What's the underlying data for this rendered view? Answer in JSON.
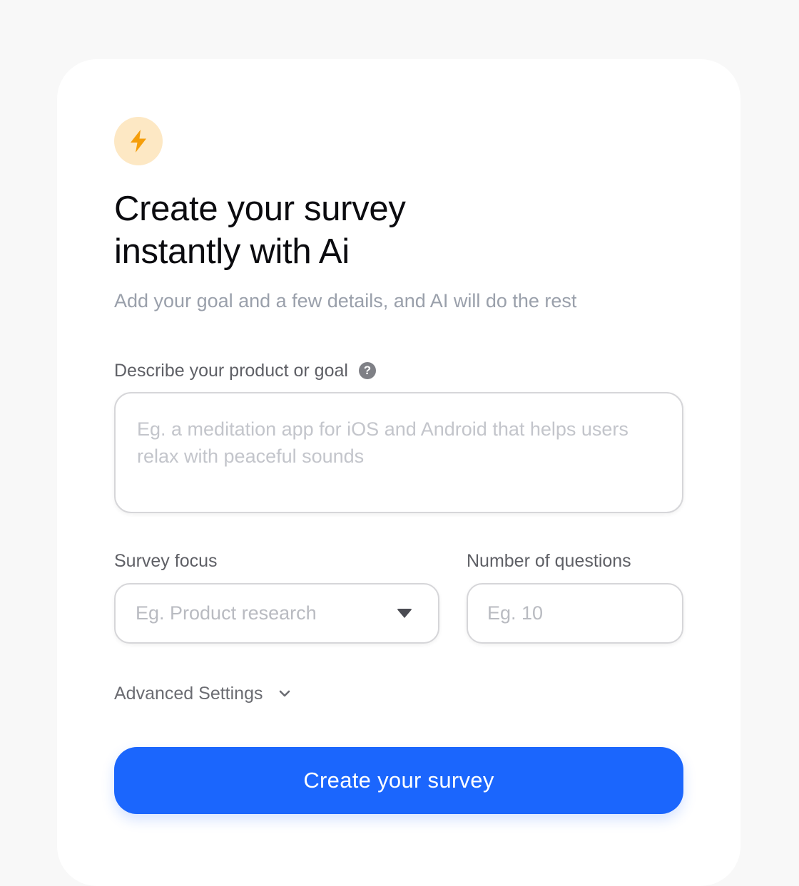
{
  "header": {
    "icon": "lightning-bolt-icon",
    "icon_color": "#f59e0b",
    "badge_color": "#fde8c4",
    "title": "Create your survey\ninstantly with Ai",
    "subtitle": "Add your goal and a few details, and AI will do the rest"
  },
  "form": {
    "description": {
      "label": "Describe your product or goal",
      "help_icon": "question-circle-icon",
      "help_glyph": "?",
      "value": "",
      "placeholder": "Eg. a meditation app for iOS and Android that helps users relax with peaceful sounds"
    },
    "focus": {
      "label": "Survey focus",
      "placeholder": "Eg. Product research",
      "icon": "caret-down-icon"
    },
    "count": {
      "label": "Number of questions",
      "placeholder": "Eg. 10",
      "value": ""
    },
    "advanced": {
      "label": "Advanced Settings",
      "icon": "chevron-down-icon"
    },
    "submit": {
      "label": "Create your survey",
      "color": "#1b66fd"
    }
  }
}
